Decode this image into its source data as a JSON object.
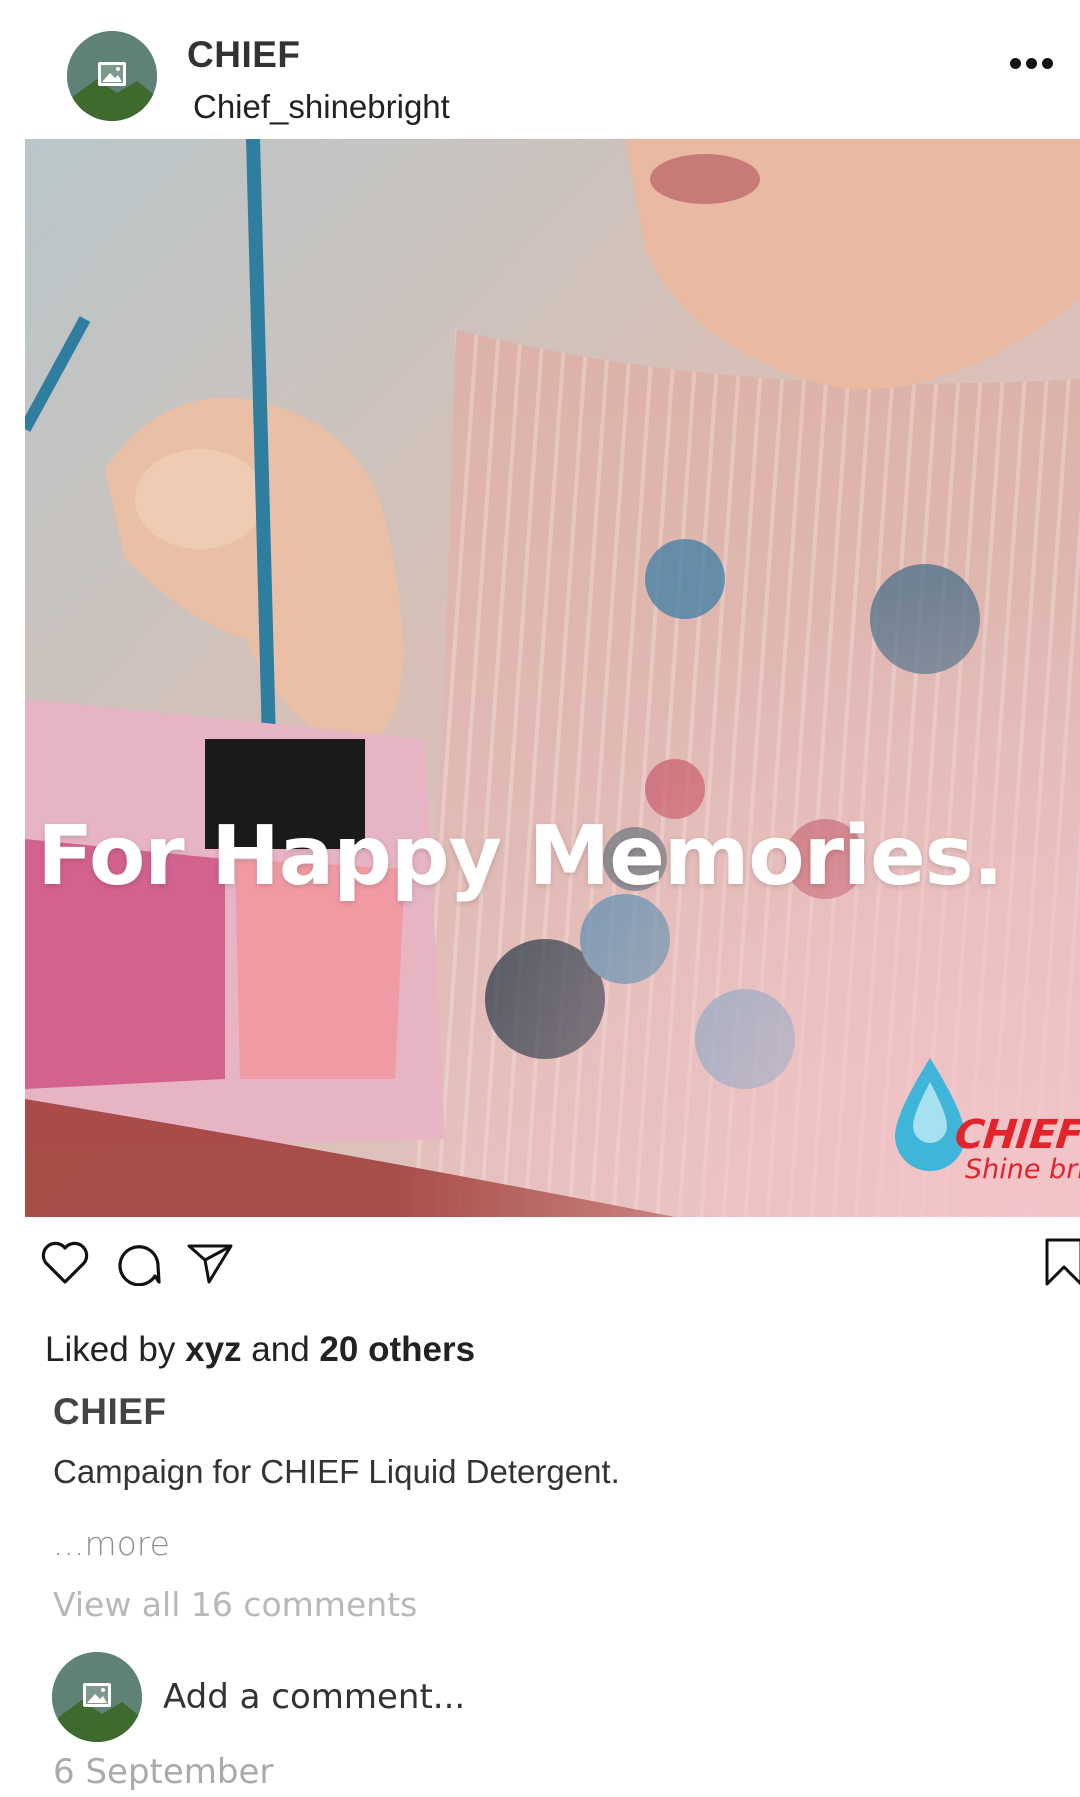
{
  "header": {
    "account_name": "CHIEF",
    "account_handle": "Chief_shinebright",
    "avatar_icon": "image-placeholder-icon",
    "more_icon": "more-horizontal-icon"
  },
  "post": {
    "image_overlay_text": "For Happy Memories.",
    "brand_logo": {
      "name": "CHIEF",
      "tagline": "Shine bright",
      "icon": "water-drop-icon"
    }
  },
  "actions": {
    "like_icon": "heart-icon",
    "comment_icon": "comment-bubble-icon",
    "share_icon": "paper-plane-icon",
    "save_icon": "bookmark-icon"
  },
  "likes": {
    "prefix": "Liked by",
    "user": "xyz",
    "joiner": "and",
    "others": "20 others"
  },
  "caption": {
    "username": "CHIEF",
    "text": "Campaign for CHIEF Liquid Detergent.",
    "more_label": "...more"
  },
  "comments": {
    "view_all_label": "View all 16 comments",
    "input_placeholder": "Add a comment..."
  },
  "date": "6 September",
  "colors": {
    "avatar_bg": "#4f7a6b",
    "brand_red": "#e3232b",
    "brand_blue": "#3fb6d9",
    "muted_text": "#aaaaaa"
  }
}
